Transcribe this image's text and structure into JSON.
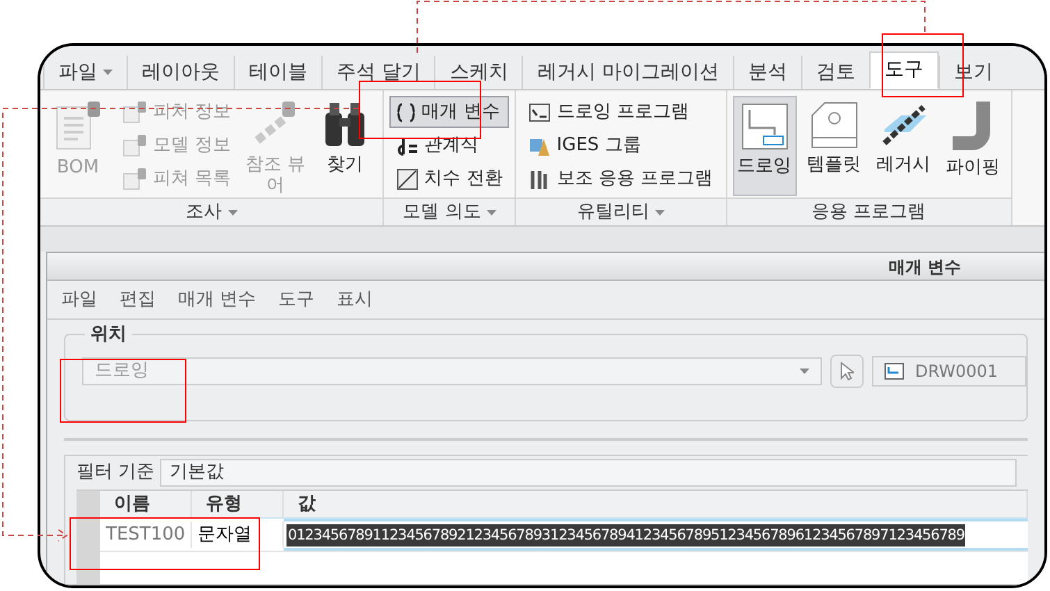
{
  "ribbon_tabs": [
    {
      "label": "파일",
      "dropdown": true,
      "selected": false
    },
    {
      "label": "레이아웃",
      "dropdown": false,
      "selected": false
    },
    {
      "label": "테이블",
      "dropdown": false,
      "selected": false
    },
    {
      "label": "주석 달기",
      "dropdown": false,
      "selected": false
    },
    {
      "label": "스케치",
      "dropdown": false,
      "selected": false
    },
    {
      "label": "레거시 마이그레이션",
      "dropdown": false,
      "selected": false
    },
    {
      "label": "분석",
      "dropdown": false,
      "selected": false
    },
    {
      "label": "검토",
      "dropdown": false,
      "selected": false
    },
    {
      "label": "도구",
      "dropdown": false,
      "selected": true
    },
    {
      "label": "보기",
      "dropdown": false,
      "selected": false
    }
  ],
  "ribbon_groups": [
    {
      "label": "조사",
      "dropdown": true,
      "items": [
        {
          "kind": "large",
          "label": "BOM",
          "disabled": true
        },
        {
          "kind": "stack",
          "items": [
            {
              "label": "피처 정보",
              "disabled": true
            },
            {
              "label": "모델 정보",
              "disabled": true
            },
            {
              "label": "피쳐 목록",
              "disabled": true
            }
          ]
        },
        {
          "kind": "large",
          "label": "참조 뷰어",
          "disabled": true
        },
        {
          "kind": "large",
          "label": "찾기",
          "disabled": false
        }
      ]
    },
    {
      "label": "모델 의도",
      "dropdown": true,
      "items": [
        {
          "kind": "stack",
          "items": [
            {
              "label": "매개 변수",
              "selected": true
            },
            {
              "label": "관계식",
              "selected": false
            },
            {
              "label": "치수 전환",
              "selected": false
            }
          ]
        }
      ]
    },
    {
      "label": "유틸리티",
      "dropdown": true,
      "items": [
        {
          "kind": "stack",
          "items": [
            {
              "label": "드로잉 프로그램"
            },
            {
              "label": "IGES 그룹"
            },
            {
              "label": "보조 응용 프로그램"
            }
          ]
        }
      ]
    },
    {
      "label": "응용 프로그램",
      "dropdown": false,
      "items": [
        {
          "kind": "large",
          "label": "드로잉",
          "selected": true
        },
        {
          "kind": "large",
          "label": "템플릿",
          "selected": false
        },
        {
          "kind": "large",
          "label": "레거시",
          "selected": false
        },
        {
          "kind": "large",
          "label": "파이핑",
          "selected": false
        }
      ]
    }
  ],
  "dialog": {
    "title": "매개 변수",
    "menu": [
      "파일",
      "편집",
      "매개 변수",
      "도구",
      "표시"
    ],
    "location": {
      "legend": "위치",
      "value": "드로잉",
      "model": "DRW0001"
    },
    "filter": {
      "label": "필터 기준",
      "value": "기본값"
    },
    "table": {
      "columns": [
        "이름",
        "유형",
        "값"
      ],
      "rows": [
        {
          "name": "TEST100",
          "type": "문자열",
          "value": "01234567891123456789212345678931234567894123456789512345678961234567897123456789",
          "selected": true
        }
      ]
    }
  }
}
